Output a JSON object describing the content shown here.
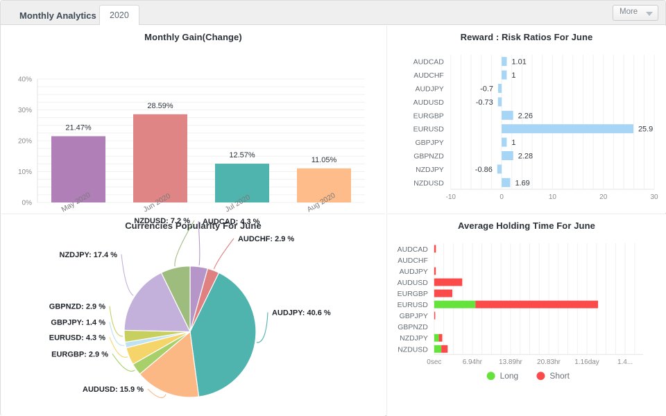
{
  "header": {
    "title": "Monthly Analytics",
    "active_tab": "2020",
    "more_label": "More",
    "caret_icon": "chevron-down-icon"
  },
  "panels": {
    "gain": {
      "title": "Monthly Gain(Change)"
    },
    "reward": {
      "title": "Reward : Risk Ratios For June"
    },
    "pie": {
      "title": "Currencies Popularity For June"
    },
    "holding": {
      "title": "Average Holding Time For June"
    }
  },
  "chart_data": [
    {
      "id": "monthly-gain",
      "type": "bar",
      "title": "Monthly Gain(Change)",
      "xlabel": "",
      "ylabel": "",
      "ylim": [
        0,
        40
      ],
      "yticks": [
        "0%",
        "10%",
        "20%",
        "30%",
        "40%"
      ],
      "ytick_values": [
        0,
        10,
        20,
        30,
        40
      ],
      "grid": true,
      "legend": "none",
      "categories": [
        "May 2020",
        "Jun 2020",
        "Jul 2020",
        "Aug 2020"
      ],
      "values": [
        21.47,
        28.59,
        12.57,
        11.05
      ],
      "value_labels": [
        "21.47%",
        "28.59%",
        "12.57%",
        "11.05%"
      ],
      "colors": [
        "#b07fb7",
        "#e08585",
        "#4fb3ae",
        "#fdbc8a"
      ]
    },
    {
      "id": "reward-risk",
      "type": "bar",
      "orientation": "horizontal",
      "title": "Reward : Risk Ratios For June",
      "xlabel": "",
      "ylabel": "",
      "xlim": [
        -10,
        30
      ],
      "xticks": [
        "-10",
        "0",
        "10",
        "20",
        "30"
      ],
      "xtick_values": [
        -10,
        0,
        10,
        20,
        30
      ],
      "grid": true,
      "legend": "none",
      "bar_color": "#a6d5f5",
      "categories": [
        "AUDCAD",
        "AUDCHF",
        "AUDJPY",
        "AUDUSD",
        "EURGBP",
        "EURUSD",
        "GBPJPY",
        "GBPNZD",
        "NZDJPY",
        "NZDUSD"
      ],
      "values": [
        1.01,
        1,
        -0.7,
        -0.73,
        2.26,
        25.9,
        1,
        2.28,
        -0.86,
        1.69
      ],
      "value_labels": [
        "1.01",
        "1",
        "-0.7",
        "-0.73",
        "2.26",
        "25.9",
        "1",
        "2.28",
        "-0.86",
        "1.69"
      ]
    },
    {
      "id": "currencies-popularity",
      "type": "pie",
      "title": "Currencies Popularity For June",
      "legend": "labels-outside",
      "labels": [
        "AUDCAD",
        "AUDCHF",
        "AUDJPY",
        "AUDUSD",
        "EURGBP",
        "EURUSD",
        "GBPJPY",
        "GBPNZD",
        "NZDJPY",
        "NZDUSD"
      ],
      "values": [
        4.3,
        2.9,
        40.6,
        15.9,
        2.9,
        4.3,
        1.4,
        2.9,
        17.4,
        7.2
      ],
      "label_texts": [
        "AUDCAD: 4.3 %",
        "AUDCHF: 2.9 %",
        "AUDJPY: 40.6 %",
        "AUDUSD: 15.9 %",
        "EURGBP: 2.9 %",
        "EURUSD: 4.3 %",
        "GBPJPY: 1.4 %",
        "GBPNZD: 2.9 %",
        "NZDJPY: 17.4 %",
        "NZDUSD: 7.2 %"
      ],
      "colors": [
        "#b696c8",
        "#e08181",
        "#4fb3ae",
        "#fbb885",
        "#a8d06a",
        "#f5d56a",
        "#bfe2f2",
        "#c7cf5e",
        "#c3b0db",
        "#9fbc7f"
      ]
    },
    {
      "id": "average-holding-time",
      "type": "bar",
      "orientation": "horizontal",
      "stacked": true,
      "title": "Average Holding Time For June",
      "xlabel": "",
      "ylabel": "",
      "xticks": [
        "0sec",
        "6.94hr",
        "13.89hr",
        "20.83hr",
        "1.16day",
        "1.4..."
      ],
      "xtick_values": [
        0,
        6.94,
        13.89,
        20.83,
        27.78,
        34.72
      ],
      "xlim": [
        0,
        38
      ],
      "grid": true,
      "legend": "bottom",
      "legend_entries": [
        {
          "label": "Long",
          "color": "#66e23c"
        },
        {
          "label": "Short",
          "color": "#fb4a4a"
        }
      ],
      "categories": [
        "AUDCAD",
        "AUDCHF",
        "AUDJPY",
        "AUDUSD",
        "EURGBP",
        "EURUSD",
        "GBPJPY",
        "GBPNZD",
        "NZDJPY",
        "NZDUSD"
      ],
      "series": [
        {
          "name": "Long",
          "color": "#66e23c",
          "values": [
            0,
            0,
            0,
            0,
            0,
            7.5,
            0,
            0,
            0.85,
            1.3
          ]
        },
        {
          "name": "Short",
          "color": "#fb4a4a",
          "values": [
            0.32,
            0,
            0.3,
            5.1,
            3.3,
            22.3,
            0.12,
            0,
            0.62,
            1.15
          ]
        }
      ]
    }
  ]
}
